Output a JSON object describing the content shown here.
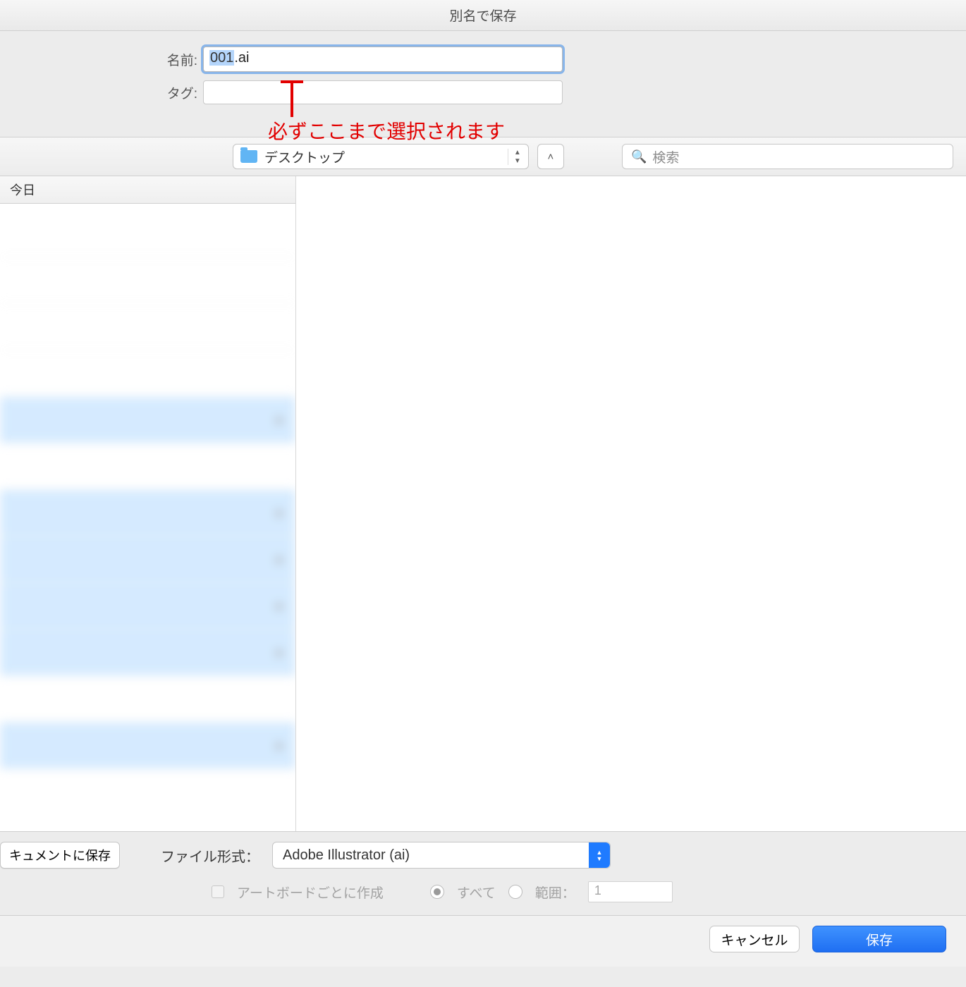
{
  "window": {
    "title": "別名で保存"
  },
  "fields": {
    "name_label": "名前:",
    "tag_label": "タグ:",
    "filename_base": "001",
    "filename_ext": ".ai"
  },
  "annotation": {
    "text": "必ずここまで選択されます"
  },
  "toolbar": {
    "folder": "デスクトップ",
    "search_placeholder": "検索"
  },
  "sidebar": {
    "section_header": "今日"
  },
  "bottom": {
    "doc_save_label": "キュメントに保存",
    "format_label": "ファイル形式：",
    "format_value": "Adobe Illustrator (ai)",
    "artboard_label": "アートボードごとに作成",
    "all_label": "すべて",
    "range_label": "範囲：",
    "range_value": "1"
  },
  "footer": {
    "cancel": "キャンセル",
    "save": "保存"
  }
}
